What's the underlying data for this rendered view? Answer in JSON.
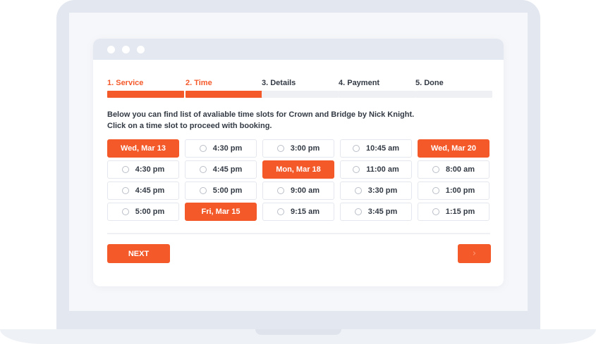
{
  "steps": [
    {
      "label": "1. Service",
      "active": true
    },
    {
      "label": "2. Time",
      "active": true
    },
    {
      "label": "3. Details",
      "active": false
    },
    {
      "label": "4. Payment",
      "active": false
    },
    {
      "label": "5. Done",
      "active": false
    }
  ],
  "intro": {
    "line1": "Below you can find list of avaliable time slots for Crown and Bridge by Nick Knight.",
    "line2": "Click on a time slot to proceed with booking."
  },
  "columns": [
    [
      {
        "type": "date",
        "text": "Wed, Mar 13"
      },
      {
        "type": "time",
        "text": "4:30 pm"
      },
      {
        "type": "time",
        "text": "4:45 pm"
      },
      {
        "type": "time",
        "text": "5:00 pm"
      }
    ],
    [
      {
        "type": "time",
        "text": "4:30 pm"
      },
      {
        "type": "time",
        "text": "4:45 pm"
      },
      {
        "type": "time",
        "text": "5:00 pm"
      },
      {
        "type": "date",
        "text": "Fri, Mar 15"
      }
    ],
    [
      {
        "type": "time",
        "text": "3:00 pm"
      },
      {
        "type": "date",
        "text": "Mon, Mar 18"
      },
      {
        "type": "time",
        "text": "9:00 am"
      },
      {
        "type": "time",
        "text": "9:15 am"
      }
    ],
    [
      {
        "type": "time",
        "text": "10:45 am"
      },
      {
        "type": "time",
        "text": "11:00 am"
      },
      {
        "type": "time",
        "text": "3:30 pm"
      },
      {
        "type": "time",
        "text": "3:45 pm"
      }
    ],
    [
      {
        "type": "date",
        "text": "Wed, Mar 20"
      },
      {
        "type": "time",
        "text": "8:00 am"
      },
      {
        "type": "time",
        "text": "1:00 pm"
      },
      {
        "type": "time",
        "text": "1:15 pm"
      }
    ]
  ],
  "buttons": {
    "next_label": "NEXT",
    "arrow_icon": "chevron-right-icon",
    "arrow_glyph": "›"
  },
  "colors": {
    "accent": "#f4592a",
    "text": "#333a44",
    "inactive_bar": "#eef0f4"
  }
}
